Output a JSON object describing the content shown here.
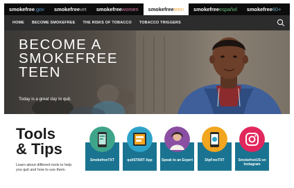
{
  "site_tabs": [
    {
      "brand": "smokefree",
      "suffix": ".gov",
      "suffix_class": "gov",
      "active": false
    },
    {
      "brand": "smokefree",
      "suffix": "vet",
      "suffix_class": "vet",
      "active": false
    },
    {
      "brand": "smokefree",
      "suffix": "women",
      "suffix_class": "women",
      "active": false
    },
    {
      "brand": "smokefree",
      "suffix": "teen",
      "suffix_class": "teen",
      "active": true
    },
    {
      "brand": "smokefree",
      "suffix": "español",
      "suffix_class": "espanol",
      "active": false
    },
    {
      "brand": "smokefree",
      "suffix": "60+",
      "suffix_class": "sixty",
      "active": false
    }
  ],
  "nav": {
    "items": [
      "HOME",
      "BECOME SMOKEFREE",
      "THE RISKS OF TOBACCO",
      "TOBACCO TRIGGERS"
    ],
    "search_icon": "search-icon"
  },
  "hero": {
    "title_lines": [
      "BECOME A",
      "SMOKEFREE",
      "TEEN"
    ],
    "subtitle": "Today is a great day to quit."
  },
  "tools": {
    "title_lines": [
      "Tools",
      "& Tips"
    ],
    "description": "Learn about different tools to help you quit and how to use them.",
    "tiles": [
      {
        "label": "SmokefreeTXT",
        "icon": "phone-text-icon",
        "circle_color": "#3fa58a"
      },
      {
        "label": "quitSTART App",
        "icon": "tablet-app-icon",
        "circle_color": "#2ea3c9"
      },
      {
        "label": "Speak to an Expert",
        "icon": "expert-headset-icon",
        "circle_color": "#8a4fa3"
      },
      {
        "label": "DipFreeTXT",
        "icon": "phone-message-icon",
        "circle_color": "#f2a51e"
      },
      {
        "label": "SmokefreeUS on Instagram",
        "icon": "instagram-icon",
        "circle_color": "#e2275d"
      }
    ]
  },
  "colors": {
    "tile_background": "#1a7491",
    "nav_background": "#2c2c2c",
    "sitebar_background": "#0c0c0c"
  }
}
